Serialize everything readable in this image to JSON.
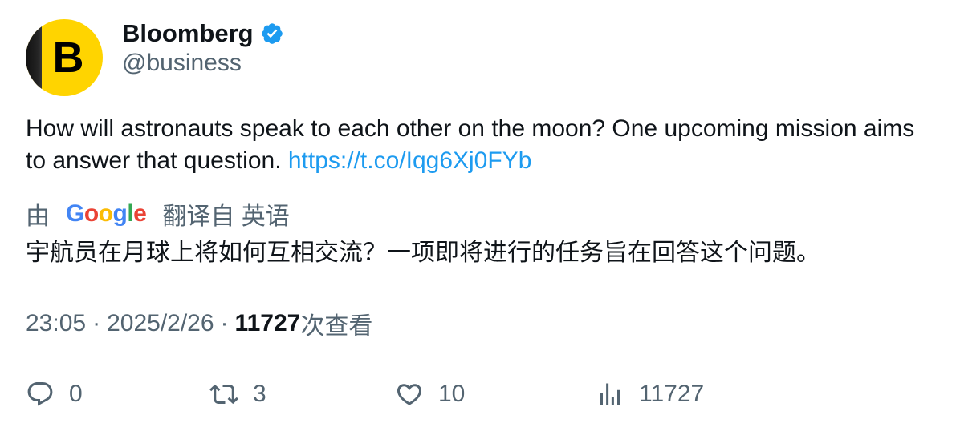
{
  "author": {
    "name": "Bloomberg",
    "handle": "@business",
    "avatar_letter": "B",
    "verified": true
  },
  "tweet": {
    "text": "How will astronauts speak to each other on the moon? One upcoming mission aims to answer that question.",
    "link": "https://t.co/Iqg6Xj0FYb"
  },
  "translation": {
    "prefix": "由",
    "google": "Google",
    "suffix": "翻译自 英语",
    "text": "宇航员在月球上将如何互相交流？一项即将进行的任务旨在回答这个问题。"
  },
  "meta": {
    "time": "23:05",
    "date": "2025/2/26",
    "views": "11727",
    "views_label": "次查看"
  },
  "actions": {
    "replies": "0",
    "retweets": "3",
    "likes": "10",
    "views": "11727"
  },
  "colors": {
    "accent": "#1d9bf0",
    "muted": "#536471",
    "text": "#0f1419",
    "avatar_bg": "#ffd400"
  }
}
